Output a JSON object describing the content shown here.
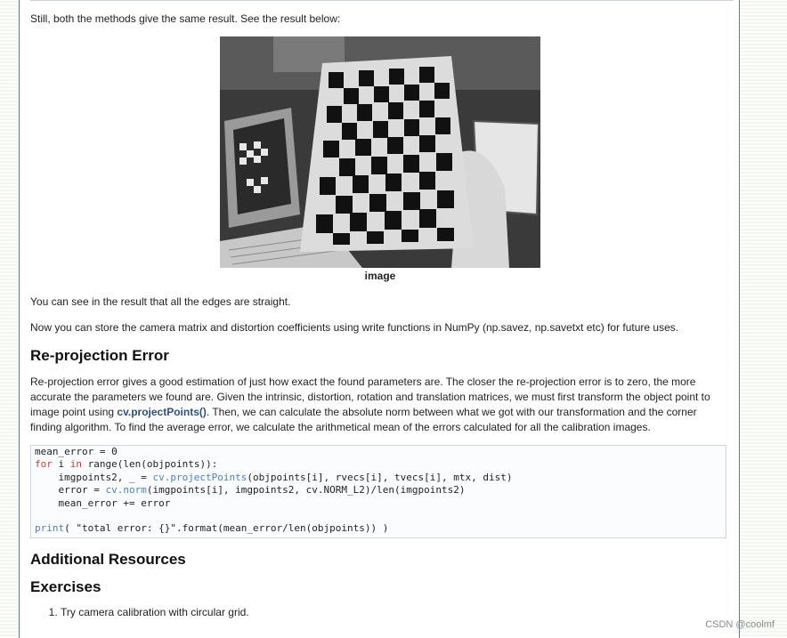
{
  "intro_text": "Still, both the methods give the same result. See the result below:",
  "figure": {
    "caption": "image"
  },
  "para_edges": "You can see in the result that all the edges are straight.",
  "para_store": "Now you can store the camera matrix and distortion coefficients using write functions in NumPy (np.savez, np.savetxt etc) for future uses.",
  "section_reprojection": {
    "heading": "Re-projection Error",
    "text_before_fn": "Re-projection error gives a good estimation of just how exact the found parameters are. The closer the re-projection error is to zero, the more accurate the parameters we found are. Given the intrinsic, distortion, rotation and translation matrices, we must first transform the object point to image point using ",
    "fn_link": "cv.projectPoints()",
    "text_after_fn": ". Then, we can calculate the absolute norm between what we got with our transformation and the corner finding algorithm. To find the average error, we calculate the arithmetical mean of the errors calculated for all the calibration images."
  },
  "code": {
    "line1": "mean_error = 0",
    "line2_kw1": "for",
    "line2_a": " i ",
    "line2_kw2": "in",
    "line2_b": " range(len(objpoints)):",
    "line3_a": "    imgpoints2, _ = ",
    "line3_fn": "cv.projectPoints",
    "line3_b": "(objpoints[i], rvecs[i], tvecs[i], mtx, dist)",
    "line4_a": "    error = ",
    "line4_fn": "cv.norm",
    "line4_b": "(imgpoints[i], imgpoints2, cv.NORM_L2)/len(imgpoints2)",
    "line5": "    mean_error += error",
    "line7_fn": "print",
    "line7_b": "( \"total error: {}\".format(mean_error/len(objpoints)) )"
  },
  "heading_additional": "Additional Resources",
  "heading_exercises": "Exercises",
  "exercises": [
    "Try camera calibration with circular grid."
  ],
  "watermark": "CSDN @coolmf"
}
